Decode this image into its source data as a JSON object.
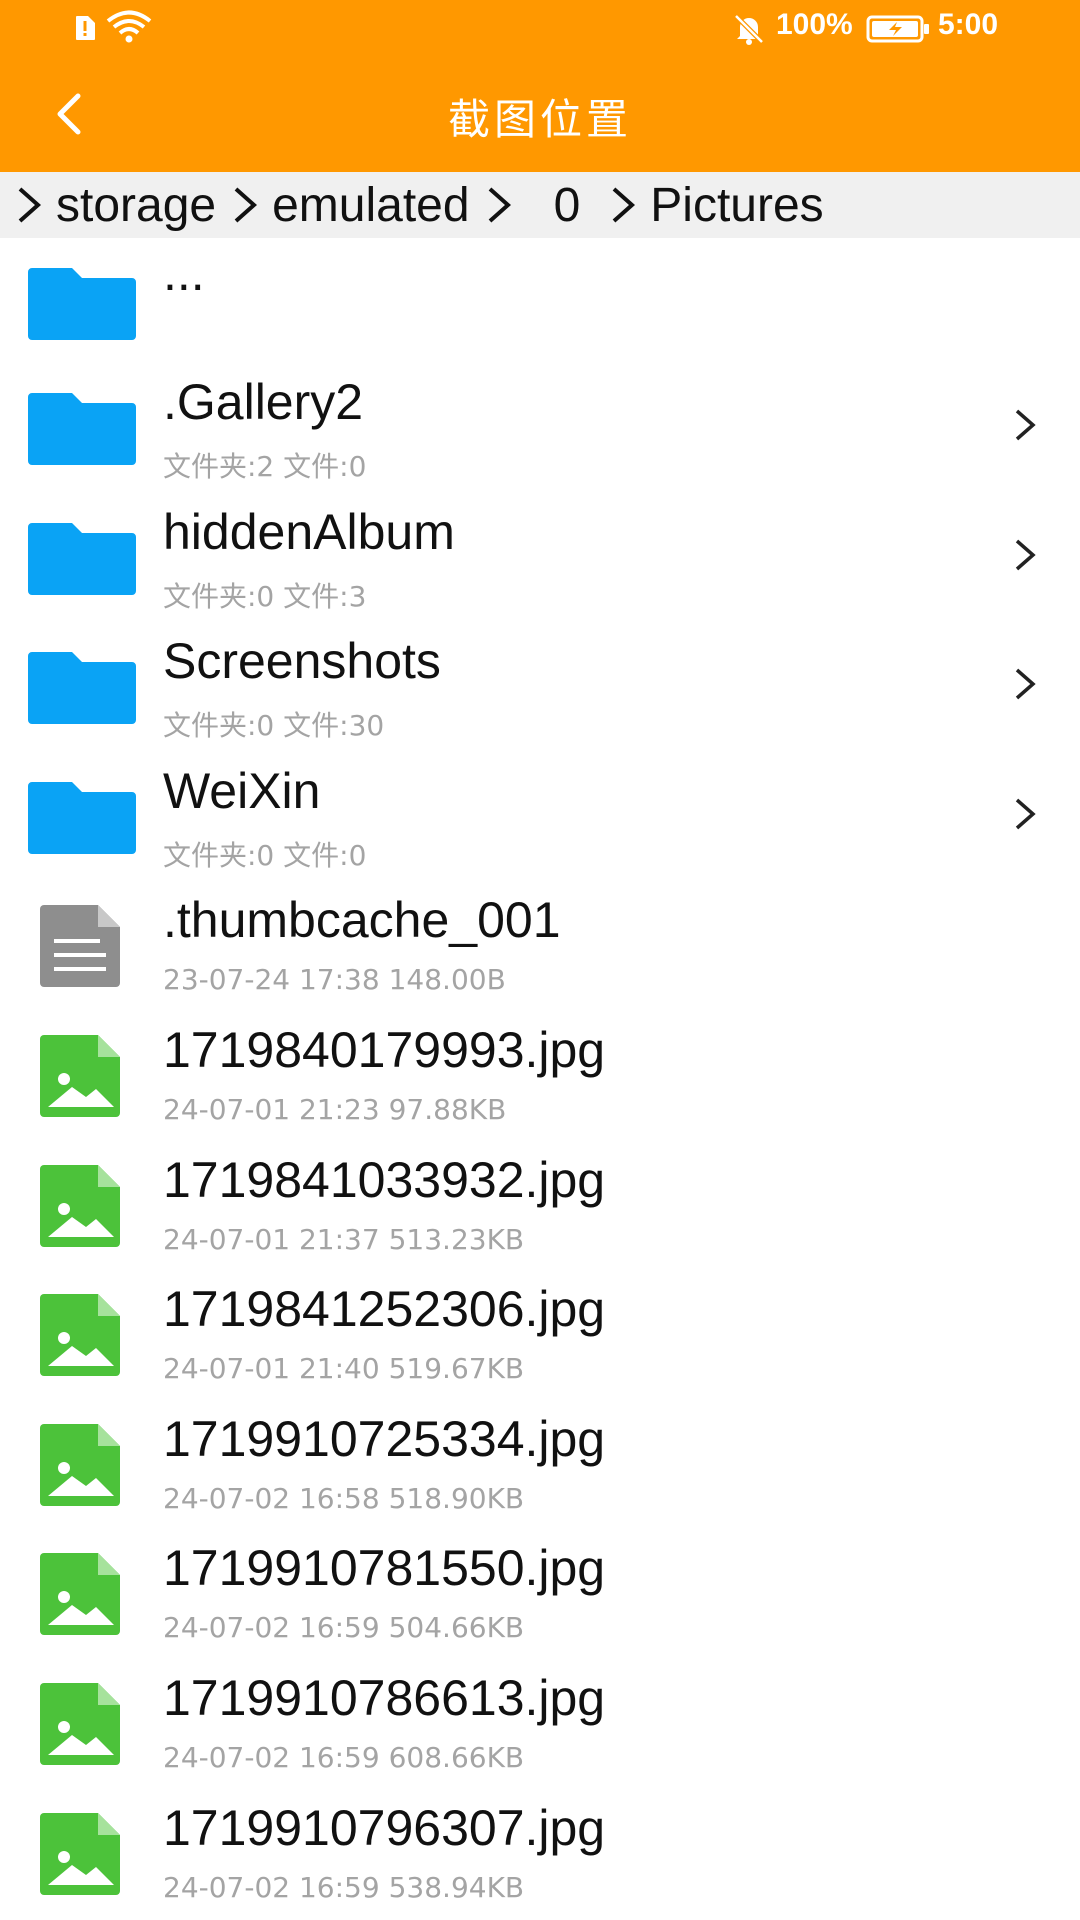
{
  "status_bar": {
    "battery_percent": "100%",
    "time": "5:00",
    "icons": [
      "sim-alert-icon",
      "wifi-icon",
      "bell-off-icon",
      "battery-charging-icon"
    ]
  },
  "header": {
    "title": "截图位置",
    "back_icon": "chevron-left-icon"
  },
  "breadcrumb": [
    "storage",
    "emulated",
    "0",
    "Pictures"
  ],
  "parent_item": {
    "name": "..."
  },
  "folders": [
    {
      "name": ".Gallery2",
      "meta": "文件夹:2 文件:0"
    },
    {
      "name": "hiddenAlbum",
      "meta": "文件夹:0 文件:3"
    },
    {
      "name": "Screenshots",
      "meta": "文件夹:0 文件:30"
    },
    {
      "name": "WeiXin",
      "meta": "文件夹:0 文件:0"
    }
  ],
  "files": [
    {
      "name": ".thumbcache_001",
      "date": "23-07-24 17:38",
      "size": "148.00B",
      "kind": "document"
    },
    {
      "name": "1719840179993.jpg",
      "date": "24-07-01 21:23",
      "size": "97.88KB",
      "kind": "image"
    },
    {
      "name": "1719841033932.jpg",
      "date": "24-07-01 21:37",
      "size": "513.23KB",
      "kind": "image"
    },
    {
      "name": "1719841252306.jpg",
      "date": "24-07-01 21:40",
      "size": "519.67KB",
      "kind": "image"
    },
    {
      "name": "1719910725334.jpg",
      "date": "24-07-02 16:58",
      "size": "518.90KB",
      "kind": "image"
    },
    {
      "name": "1719910781550.jpg",
      "date": "24-07-02 16:59",
      "size": "504.66KB",
      "kind": "image"
    },
    {
      "name": "1719910786613.jpg",
      "date": "24-07-02 16:59",
      "size": "608.66KB",
      "kind": "image"
    },
    {
      "name": "1719910796307.jpg",
      "date": "24-07-02 16:59",
      "size": "538.94KB",
      "kind": "image"
    }
  ],
  "colors": {
    "appbar": "#FF9800",
    "folder": "#0AA3F5",
    "image_file": "#4CC23A",
    "document_file": "#8E8E8E",
    "meta_text": "#A4A4A4"
  }
}
